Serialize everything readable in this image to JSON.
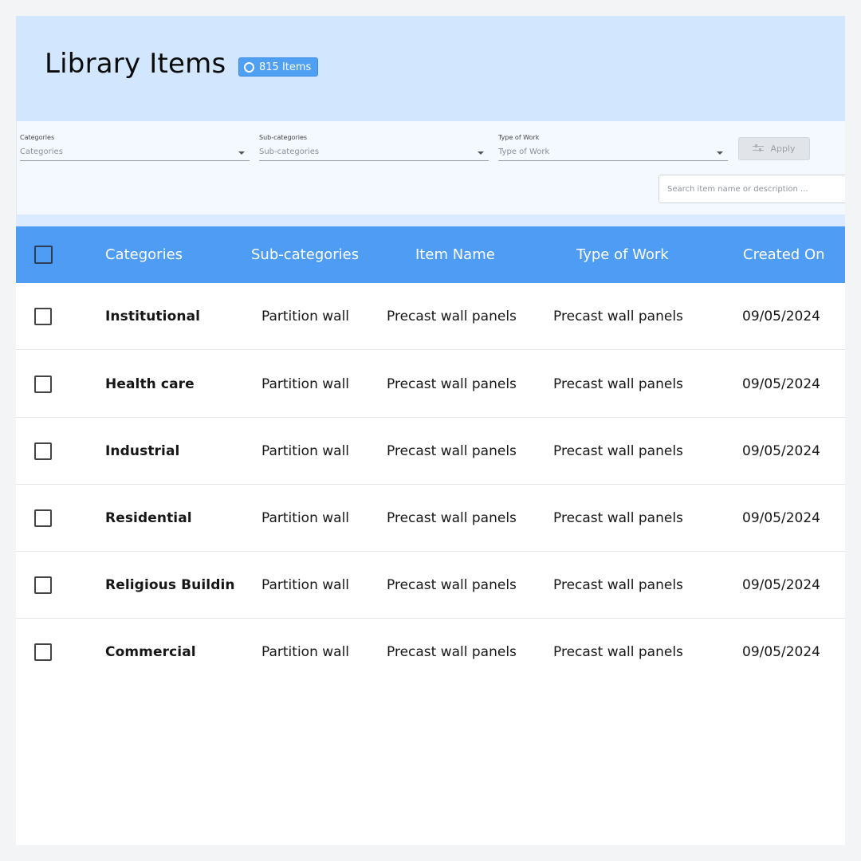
{
  "header": {
    "title": "Library Items",
    "item_count": "815 Items"
  },
  "filters": {
    "categories": {
      "label": "Categories",
      "placeholder": "Categories"
    },
    "sub_categories": {
      "label": "Sub-categories",
      "placeholder": "Sub-categories"
    },
    "type_of_work": {
      "label": "Type of Work",
      "placeholder": "Type of Work"
    },
    "apply_label": "Apply",
    "search_placeholder": "Search item name or description ..."
  },
  "table": {
    "columns": [
      "Categories",
      "Sub-categories",
      "Item Name",
      "Type of Work",
      "Created On"
    ],
    "rows": [
      {
        "category": "Institutional",
        "sub_category": "Partition wall",
        "item_name": "Precast wall panels",
        "type_of_work": "Precast wall panels",
        "created_on": "09/05/2024"
      },
      {
        "category": "Health care",
        "sub_category": "Partition wall",
        "item_name": "Precast wall panels",
        "type_of_work": "Precast wall panels",
        "created_on": "09/05/2024"
      },
      {
        "category": "Industrial",
        "sub_category": "Partition wall",
        "item_name": "Precast wall panels",
        "type_of_work": "Precast wall panels",
        "created_on": "09/05/2024"
      },
      {
        "category": "Residential",
        "sub_category": "Partition wall",
        "item_name": "Precast wall panels",
        "type_of_work": "Precast wall panels",
        "created_on": "09/05/2024"
      },
      {
        "category": "Religious Buildin",
        "sub_category": "Partition wall",
        "item_name": "Precast wall panels",
        "type_of_work": "Precast wall panels",
        "created_on": "09/05/2024"
      },
      {
        "category": "Commercial",
        "sub_category": "Partition wall",
        "item_name": "Precast wall panels",
        "type_of_work": "Precast wall panels",
        "created_on": "09/05/2024"
      }
    ]
  },
  "colors": {
    "header_bg": "#d2e6fe",
    "table_header_bg": "#4e9cf4",
    "badge_bg": "#4f9ff2"
  }
}
